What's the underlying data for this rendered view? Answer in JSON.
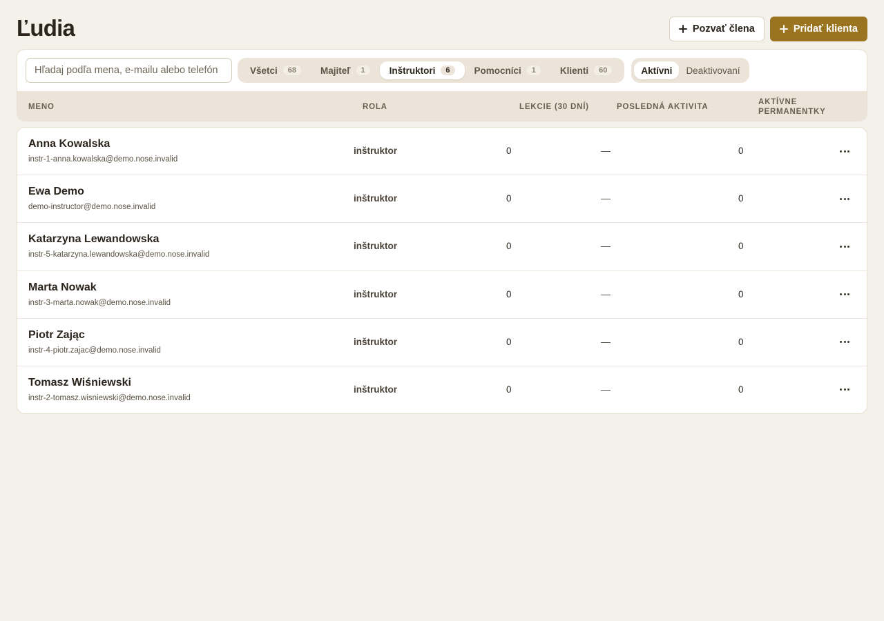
{
  "page": {
    "title": "Ľudia"
  },
  "header": {
    "invite_label": "Pozvať člena",
    "add_client_label": "Pridať klienta"
  },
  "search": {
    "placeholder": "Hľadaj podľa mena, e-mailu alebo telefón",
    "value": ""
  },
  "role_tabs": [
    {
      "label": "Všetci",
      "count": "68",
      "active": false
    },
    {
      "label": "Majiteľ",
      "count": "1",
      "active": false
    },
    {
      "label": "Inštruktori",
      "count": "6",
      "active": true
    },
    {
      "label": "Pomocníci",
      "count": "1",
      "active": false
    },
    {
      "label": "Klienti",
      "count": "60",
      "active": false
    }
  ],
  "status_tabs": [
    {
      "label": "Aktívni",
      "active": true
    },
    {
      "label": "Deaktivovaní",
      "active": false
    }
  ],
  "table": {
    "columns": {
      "name": "MENO",
      "role": "ROLA",
      "lessons": "LEKCIE (30 DNÍ)",
      "last_activity": "POSLEDNÁ AKTIVITA",
      "passes_line1": "AKTÍVNE",
      "passes_line2": "PERMANENTKY"
    },
    "rows": [
      {
        "name": "Anna Kowalska",
        "email": "instr-1-anna.kowalska@demo.nose.invalid",
        "role": "inštruktor",
        "lessons": "0",
        "last_activity": "—",
        "passes": "0"
      },
      {
        "name": "Ewa Demo",
        "email": "demo-instructor@demo.nose.invalid",
        "role": "inštruktor",
        "lessons": "0",
        "last_activity": "—",
        "passes": "0"
      },
      {
        "name": "Katarzyna Lewandowska",
        "email": "instr-5-katarzyna.lewandowska@demo.nose.invalid",
        "role": "inštruktor",
        "lessons": "0",
        "last_activity": "—",
        "passes": "0"
      },
      {
        "name": "Marta Nowak",
        "email": "instr-3-marta.nowak@demo.nose.invalid",
        "role": "inštruktor",
        "lessons": "0",
        "last_activity": "—",
        "passes": "0"
      },
      {
        "name": "Piotr Zając",
        "email": "instr-4-piotr.zajac@demo.nose.invalid",
        "role": "inštruktor",
        "lessons": "0",
        "last_activity": "—",
        "passes": "0"
      },
      {
        "name": "Tomasz Wiśniewski",
        "email": "instr-2-tomasz.wisniewski@demo.nose.invalid",
        "role": "inštruktor",
        "lessons": "0",
        "last_activity": "—",
        "passes": "0"
      }
    ]
  },
  "colors": {
    "background": "#f4f1eb",
    "primary": "#9a7420",
    "header_band": "#ece4d8"
  },
  "icons": {
    "add": "plus-icon",
    "row_menu": "more-horizontal-icon"
  }
}
